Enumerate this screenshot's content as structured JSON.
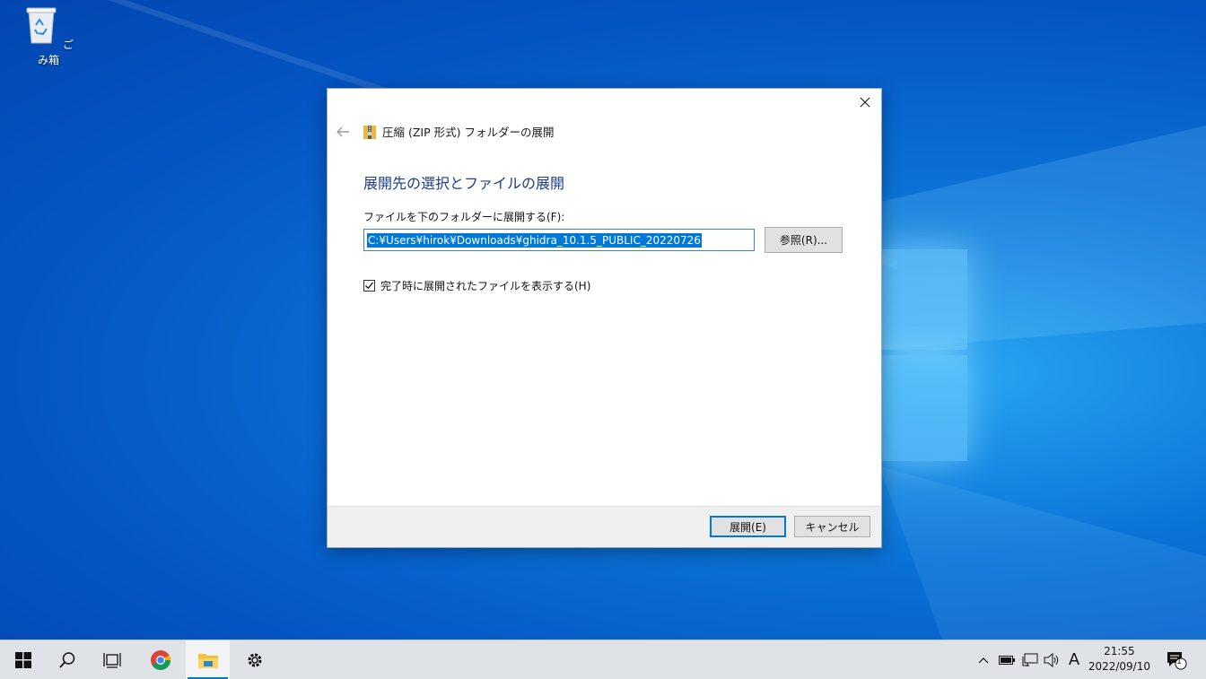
{
  "desktop": {
    "recycle_bin_label": "ごみ箱"
  },
  "dialog": {
    "wizard_title": "圧縮 (ZIP 形式) フォルダーの展開",
    "main_title": "展開先の選択とファイルの展開",
    "field_label": "ファイルを下のフォルダーに展開する(F):",
    "path_value": "C:¥Users¥hirok¥Downloads¥ghidra_10.1.5_PUBLIC_20220726",
    "browse_label": "参照(R)...",
    "checkbox_label": "完了時に展開されたファイルを表示する(H)",
    "checkbox_checked": true,
    "extract_label": "展開(E)",
    "cancel_label": "キャンセル"
  },
  "taskbar": {
    "items": [
      "start-icon",
      "search-icon",
      "task-view-icon",
      "chrome-icon",
      "file-explorer-icon",
      "settings-icon"
    ],
    "ime_indicator": "A",
    "time": "21:55",
    "date": "2022/09/10",
    "notification_count": "1"
  },
  "colors": {
    "accent": "#0078d7",
    "title_blue": "#1c3e8a",
    "desktop_blue": "#0a72d6"
  }
}
